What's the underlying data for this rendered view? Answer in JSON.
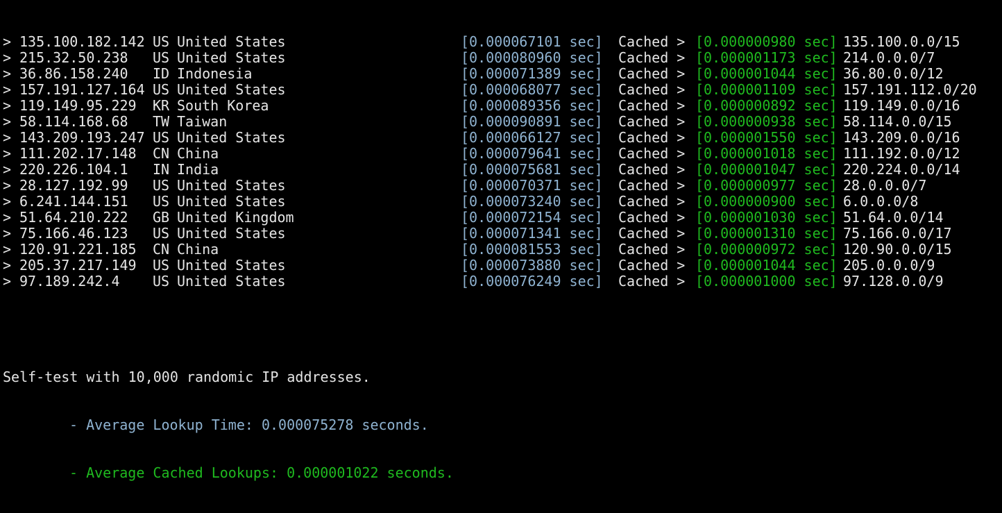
{
  "prompt_symbol": ">",
  "cached_label": "Cached >",
  "colors": {
    "background": "#000000",
    "text": "#e6e6e6",
    "lookup_time": "#8fb3d1",
    "cached_time": "#1fba1f"
  },
  "rows": [
    {
      "ip": "135.100.182.142",
      "cc": "US",
      "country": "United States",
      "lookup": "[0.000067101 sec]",
      "cached": "[0.000000980 sec]",
      "network": "135.100.0.0/15"
    },
    {
      "ip": "215.32.50.238",
      "cc": "US",
      "country": "United States",
      "lookup": "[0.000080960 sec]",
      "cached": "[0.000001173 sec]",
      "network": "214.0.0.0/7"
    },
    {
      "ip": "36.86.158.240",
      "cc": "ID",
      "country": "Indonesia",
      "lookup": "[0.000071389 sec]",
      "cached": "[0.000001044 sec]",
      "network": "36.80.0.0/12"
    },
    {
      "ip": "157.191.127.164",
      "cc": "US",
      "country": "United States",
      "lookup": "[0.000068077 sec]",
      "cached": "[0.000001109 sec]",
      "network": "157.191.112.0/20"
    },
    {
      "ip": "119.149.95.229",
      "cc": "KR",
      "country": "South Korea",
      "lookup": "[0.000089356 sec]",
      "cached": "[0.000000892 sec]",
      "network": "119.149.0.0/16"
    },
    {
      "ip": "58.114.168.68",
      "cc": "TW",
      "country": "Taiwan",
      "lookup": "[0.000090891 sec]",
      "cached": "[0.000000938 sec]",
      "network": "58.114.0.0/15"
    },
    {
      "ip": "143.209.193.247",
      "cc": "US",
      "country": "United States",
      "lookup": "[0.000066127 sec]",
      "cached": "[0.000001550 sec]",
      "network": "143.209.0.0/16"
    },
    {
      "ip": "111.202.17.148",
      "cc": "CN",
      "country": "China",
      "lookup": "[0.000079641 sec]",
      "cached": "[0.000001018 sec]",
      "network": "111.192.0.0/12"
    },
    {
      "ip": "220.226.104.1",
      "cc": "IN",
      "country": "India",
      "lookup": "[0.000075681 sec]",
      "cached": "[0.000001047 sec]",
      "network": "220.224.0.0/14"
    },
    {
      "ip": "28.127.192.99",
      "cc": "US",
      "country": "United States",
      "lookup": "[0.000070371 sec]",
      "cached": "[0.000000977 sec]",
      "network": "28.0.0.0/7"
    },
    {
      "ip": "6.241.144.151",
      "cc": "US",
      "country": "United States",
      "lookup": "[0.000073240 sec]",
      "cached": "[0.000000900 sec]",
      "network": "6.0.0.0/8"
    },
    {
      "ip": "51.64.210.222",
      "cc": "GB",
      "country": "United Kingdom",
      "lookup": "[0.000072154 sec]",
      "cached": "[0.000001030 sec]",
      "network": "51.64.0.0/14"
    },
    {
      "ip": "75.166.46.123",
      "cc": "US",
      "country": "United States",
      "lookup": "[0.000071341 sec]",
      "cached": "[0.000001310 sec]",
      "network": "75.166.0.0/17"
    },
    {
      "ip": "120.91.221.185",
      "cc": "CN",
      "country": "China",
      "lookup": "[0.000081553 sec]",
      "cached": "[0.000000972 sec]",
      "network": "120.90.0.0/15"
    },
    {
      "ip": "205.37.217.149",
      "cc": "US",
      "country": "United States",
      "lookup": "[0.000073880 sec]",
      "cached": "[0.000001044 sec]",
      "network": "205.0.0.0/9"
    },
    {
      "ip": "97.189.242.4",
      "cc": "US",
      "country": "United States",
      "lookup": "[0.000076249 sec]",
      "cached": "[0.000001000 sec]",
      "network": "97.128.0.0/9"
    }
  ],
  "summary": {
    "title": "Self-test with 10,000 randomic IP addresses.",
    "average_lookup": "- Average Lookup Time: 0.000075278 seconds.",
    "average_cached": "- Average Cached Lookups: 0.000001022 seconds."
  }
}
